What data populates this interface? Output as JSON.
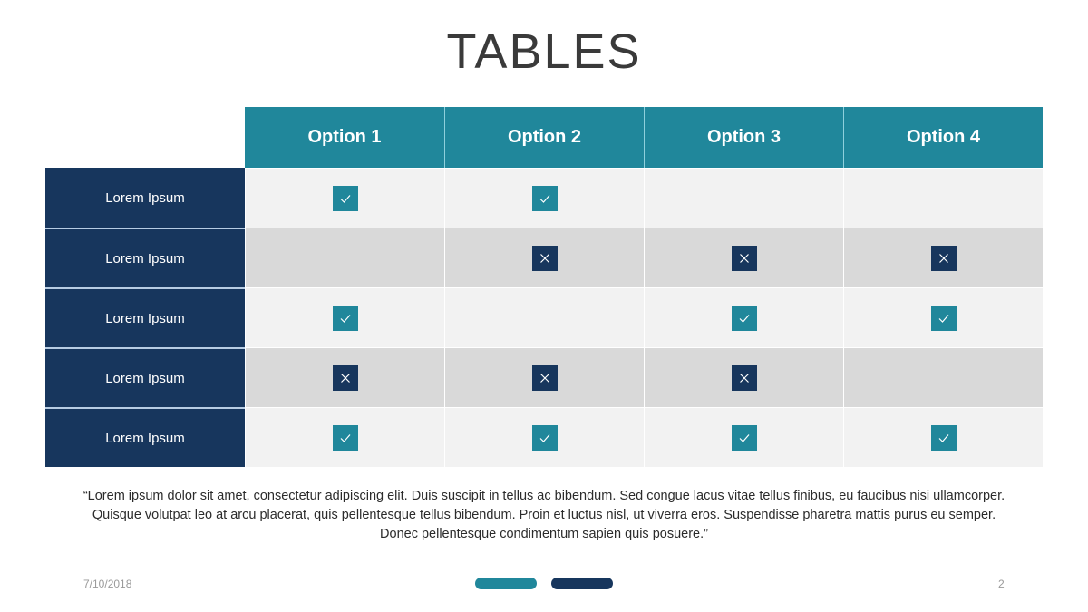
{
  "title": "TABLES",
  "table": {
    "columns": [
      "Option 1",
      "Option 2",
      "Option 3",
      "Option 4"
    ],
    "rows": [
      {
        "label": "Lorem Ipsum",
        "values": [
          "check",
          "check",
          "empty",
          "empty"
        ]
      },
      {
        "label": "Lorem Ipsum",
        "values": [
          "empty",
          "cross",
          "cross",
          "cross"
        ]
      },
      {
        "label": "Lorem Ipsum",
        "values": [
          "check",
          "empty",
          "check",
          "check"
        ]
      },
      {
        "label": "Lorem Ipsum",
        "values": [
          "cross",
          "cross",
          "cross",
          "empty"
        ]
      },
      {
        "label": "Lorem Ipsum",
        "values": [
          "check",
          "check",
          "check",
          "check"
        ]
      }
    ],
    "icons": {
      "check": "check-icon",
      "cross": "cross-icon"
    }
  },
  "quote": "“Lorem ipsum dolor sit amet, consectetur adipiscing elit. Duis suscipit in tellus ac bibendum. Sed congue lacus vitae tellus finibus, eu faucibus nisi ullamcorper. Quisque volutpat leo at arcu placerat, quis pellentesque tellus bibendum. Proin et luctus nisl, ut viverra eros. Suspendisse pharetra mattis purus eu semper. Donec pellentesque condimentum sapien quis posuere.”",
  "footer": {
    "date": "7/10/2018",
    "page_number": "2"
  },
  "colors": {
    "teal": "#20879b",
    "navy": "#17365d",
    "row_light": "#f2f2f2",
    "row_dark": "#d9d9d9"
  }
}
